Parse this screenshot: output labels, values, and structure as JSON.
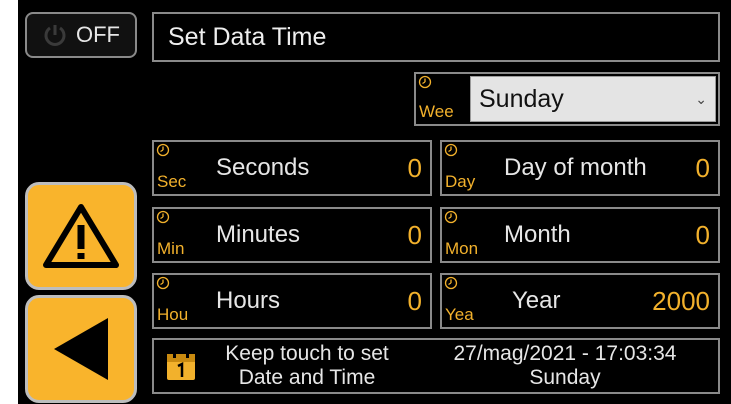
{
  "power_button": {
    "label": "OFF",
    "icon": "power-icon"
  },
  "title": "Set Data Time",
  "weekday": {
    "tag": "Wee",
    "selected": "Sunday",
    "icon": "clock-icon"
  },
  "fields": {
    "seconds": {
      "tag": "Sec",
      "label": "Seconds",
      "value": "0"
    },
    "minutes": {
      "tag": "Min",
      "label": "Minutes",
      "value": "0"
    },
    "hours": {
      "tag": "Hou",
      "label": "Hours",
      "value": "0"
    },
    "day": {
      "tag": "Day",
      "label": "Day of month",
      "value": "0"
    },
    "month": {
      "tag": "Mon",
      "label": "Month",
      "value": "0"
    },
    "year": {
      "tag": "Yea",
      "label": "Year",
      "value": "2000"
    }
  },
  "side_buttons": {
    "alarm_icon": "warning-icon",
    "back_icon": "back-arrow-icon"
  },
  "bottom": {
    "line1": "Keep touch to set",
    "line2": "Date and Time",
    "datetime": "27/mag/2021 - 17:03:34",
    "day": "Sunday",
    "icon": "calendar-icon"
  },
  "colors": {
    "accent": "#f9b42c",
    "tag": "#f2b12c",
    "border": "#8a8a8a",
    "background": "#000000"
  }
}
